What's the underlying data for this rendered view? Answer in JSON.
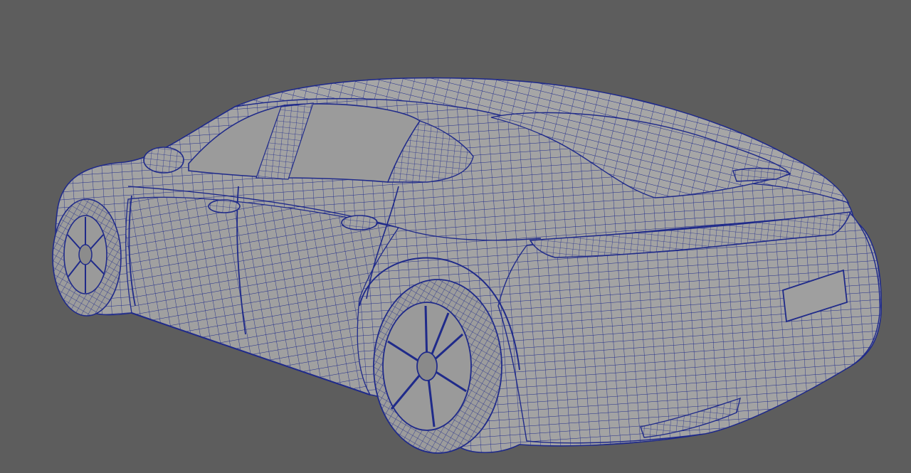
{
  "viewport": {
    "background_color": "#5d5d5d",
    "wire_color": "#1f2a8a",
    "surface_color": "#a3a3a3",
    "glass_color": "#9a9a9a",
    "shading": "wireframe-on-shaded"
  },
  "scene": {
    "object": "car-body-mesh"
  }
}
